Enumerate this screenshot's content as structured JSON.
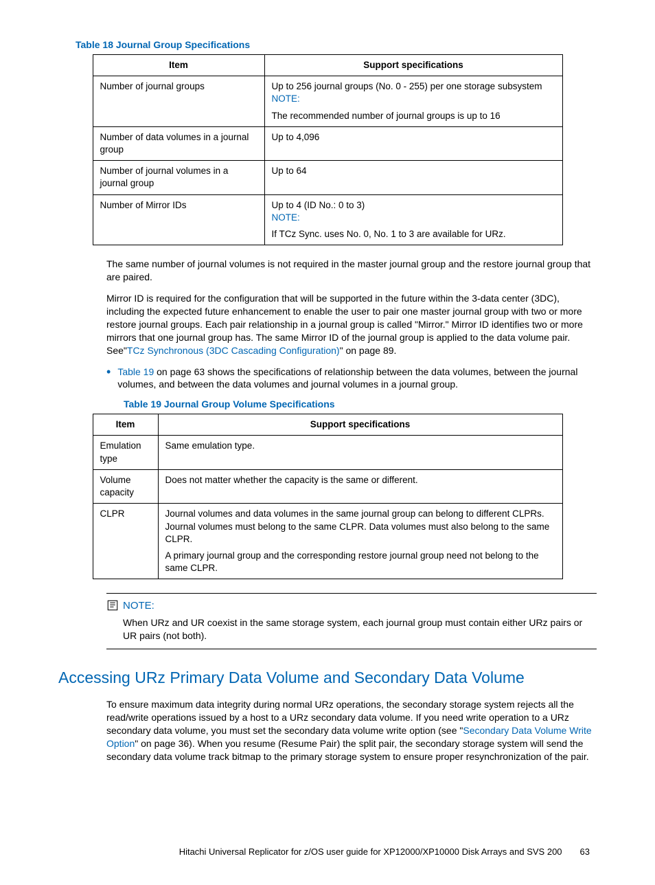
{
  "table18": {
    "caption": "Table 18 Journal Group Specifications",
    "headers": [
      "Item",
      "Support specifications"
    ],
    "rows": [
      {
        "item": "Number of journal groups",
        "spec_line1": "Up to 256 journal groups (No. 0 - 255) per one storage subsystem",
        "spec_note_label": "NOTE:",
        "spec_note_text": "The recommended number of journal groups is up to 16"
      },
      {
        "item": "Number of data volumes in a journal group",
        "spec_line1": "Up to 4,096"
      },
      {
        "item": "Number of journal volumes in a journal group",
        "spec_line1": "Up to 64"
      },
      {
        "item": "Number of Mirror IDs",
        "spec_line1": "Up to 4 (ID No.: 0 to 3)",
        "spec_note_label": "NOTE:",
        "spec_note_text": "If TCz Sync. uses No. 0, No. 1 to 3 are available for URz."
      }
    ]
  },
  "para1": "The same number of journal volumes is not required in the master journal group and the restore journal group that are paired.",
  "para2_a": "Mirror ID is required for the configuration that will be supported in the future within the 3-data center (3DC), including the expected future enhancement to enable the user to pair one master journal group with two or more restore journal groups. Each pair relationship in a journal group is called \"Mirror.\" Mirror ID identifies two or more mirrors that one journal group has. The same Mirror ID of the journal group is applied to the data volume pair. See\"",
  "para2_link": "TCz Synchronous (3DC Cascading Configuration)",
  "para2_b": "\" on page 89.",
  "bullet1_link": "Table 19",
  "bullet1_text": " on page 63 shows the specifications of relationship between the data volumes, between the journal volumes, and between the data volumes and journal volumes in a journal group.",
  "table19": {
    "caption": "Table 19 Journal Group Volume Specifications",
    "headers": [
      "Item",
      "Support specifications"
    ],
    "rows": [
      {
        "item": "Emulation type",
        "spec": "Same emulation type."
      },
      {
        "item": "Volume capacity",
        "spec": "Does not matter whether the capacity is the same or different."
      },
      {
        "item": "CLPR",
        "spec_p1": "Journal volumes and data volumes in the same journal group can belong to different CLPRs. Journal volumes must belong to the same CLPR. Data volumes must also belong to the same CLPR.",
        "spec_p2": "A primary journal group and the corresponding restore journal group need not belong to the same CLPR."
      }
    ]
  },
  "pagenote": {
    "label": "NOTE:",
    "text": "When URz and UR coexist in the same storage system, each journal group must contain either URz pairs or UR pairs (not both)."
  },
  "section_heading": "Accessing URz Primary Data Volume and Secondary Data Volume",
  "section_para_a": "To ensure maximum data integrity during normal URz operations, the secondary storage system rejects all the read/write operations issued by a host to a URz secondary data volume. If you need write operation to a URz secondary data volume, you must set the secondary data volume write option (see \"",
  "section_para_link": "Secondary Data Volume Write Option",
  "section_para_b": "\" on page 36). When you resume (Resume Pair) the split pair, the secondary storage system will send the secondary data volume track bitmap to the primary storage system to ensure proper resynchronization of the pair.",
  "footer": {
    "title": "Hitachi Universal Replicator for z/OS user guide for XP12000/XP10000 Disk Arrays and SVS 200",
    "page": "63"
  }
}
